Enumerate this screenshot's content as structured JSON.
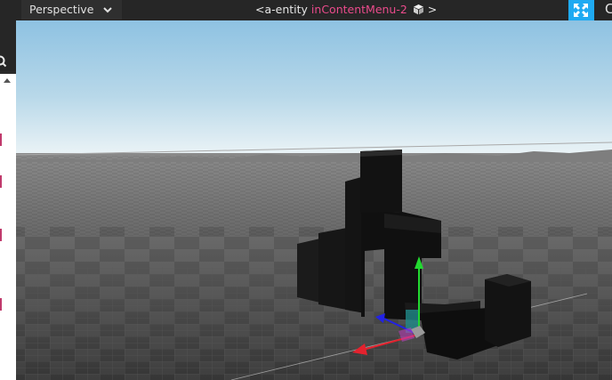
{
  "toolbar": {
    "camera_mode": "Perspective",
    "entity_tag": "<a-entity",
    "entity_id": "inContentMenu-2",
    "entity_close": ">"
  },
  "icons": {
    "camera_dropdown": "chevron-down-icon",
    "entity": "cube-icon",
    "fullscreen": "fullscreen-icon",
    "search": "search-icon",
    "scroll_up": "caret-up-icon"
  },
  "colors": {
    "accent_blue": "#1faaf2",
    "entity_id_pink": "#ea4b8b",
    "toolbar_bg": "#262626",
    "sky_top": "#8ec2e2",
    "sky_horizon": "#eef5f7",
    "gizmo_x": "#e4222e",
    "gizmo_y": "#22d930",
    "gizmo_z": "#2222e6"
  }
}
